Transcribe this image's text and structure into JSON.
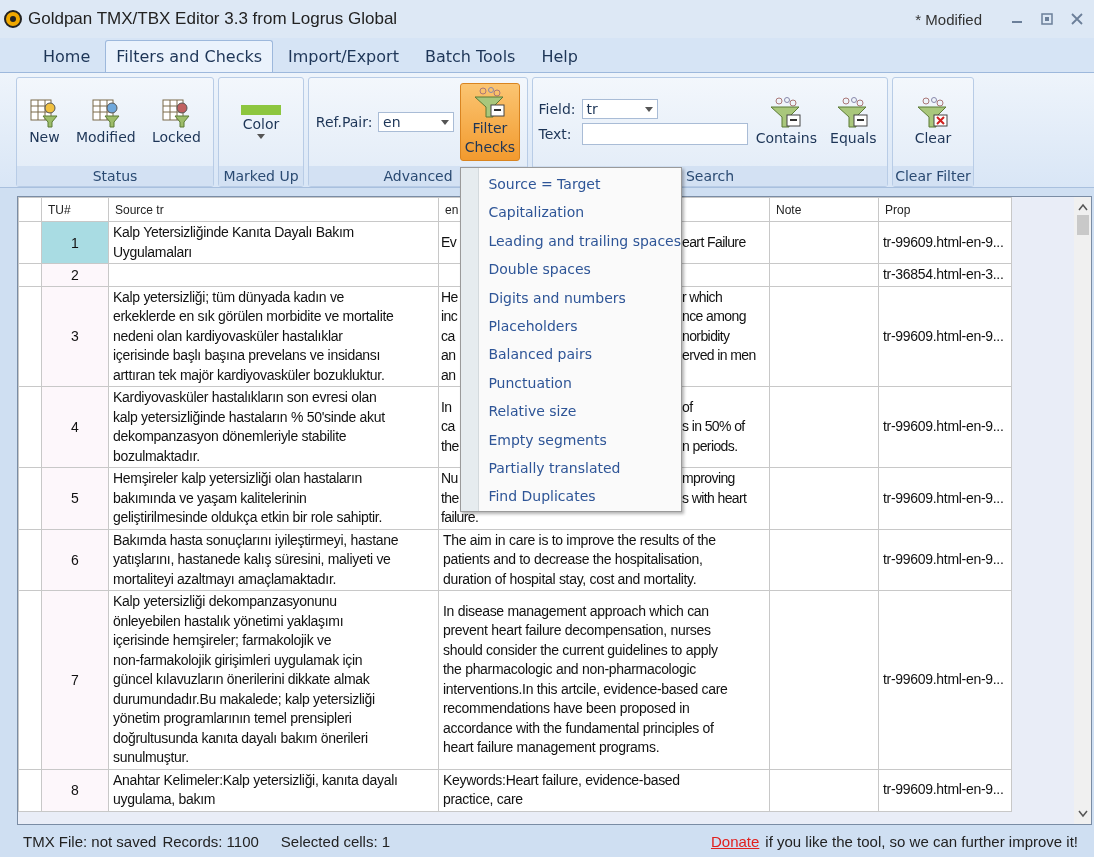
{
  "window": {
    "title": "Goldpan TMX/TBX Editor 3.3 from Logrus Global",
    "state": "* Modified"
  },
  "tabs": [
    {
      "label": "Home",
      "selected": false
    },
    {
      "label": "Filters and Checks",
      "selected": true
    },
    {
      "label": "Import/Export",
      "selected": false
    },
    {
      "label": "Batch Tools",
      "selected": false
    },
    {
      "label": "Help",
      "selected": false
    }
  ],
  "ribbon": {
    "groups": [
      {
        "kind": "status",
        "label": "Status",
        "buttons": [
          "New",
          "Modified",
          "Locked"
        ]
      },
      {
        "kind": "markup",
        "label": "Marked Up",
        "button": "Color",
        "color": "#8dc63f"
      },
      {
        "kind": "advanced",
        "label": "Advanced",
        "field_label": "Ref.Pair:",
        "field_value": "en",
        "button": "Filter\nChecks",
        "pressed": true
      },
      {
        "kind": "search",
        "label": "Search",
        "field_label": "Field:",
        "field_value": "tr",
        "text_label": "Text:",
        "buttons": [
          "Contains",
          "Equals"
        ]
      },
      {
        "kind": "clear",
        "label": "Clear Filter",
        "button": "Clear"
      }
    ]
  },
  "menu": {
    "items": [
      "Source = Target",
      "Capitalization",
      "Leading and trailing spaces",
      "Double spaces",
      "Digits and numbers",
      "Placeholders",
      "Balanced pairs",
      "Punctuation",
      "Relative size",
      "Empty segments",
      "Partially translated",
      "Find Duplicates"
    ]
  },
  "table": {
    "columns": [
      "TU#",
      "Source tr",
      "en",
      "Note",
      "Prop"
    ],
    "rows": [
      {
        "tu": "1",
        "selected": true,
        "source": "Kalp Yetersizliğinde Kanıta Dayalı Bakım\nUygulamaları",
        "target_fragments": [
          {
            "left": "Ev",
            "right": "eart Failure"
          }
        ],
        "prop": "tr-99609.html-en-9..."
      },
      {
        "tu": "2",
        "selected": false,
        "prop": "tr-36854.html-en-3..."
      },
      {
        "tu": "3",
        "selected": false,
        "source": "Kalp yetersizliği; tüm dünyada kadın ve\nerkeklerde en sık görülen morbidite ve mortalite\nnedeni olan kardiyovasküler hastalıklar\niçerisinde başlı başına prevelans ve insidansı\narttıran tek majör kardiyovasküler bozukluktur.",
        "target_fragments": [
          {
            "left": "He",
            "right": "r which"
          },
          {
            "left": "inc",
            "right": "nce among"
          },
          {
            "left": "ca",
            "right": "norbidity"
          },
          {
            "left": "an",
            "right": "erved in men"
          },
          {
            "left": "an"
          }
        ],
        "prop": "tr-99609.html-en-9..."
      },
      {
        "tu": "4",
        "selected": false,
        "source": "Kardiyovasküler hastalıkların son evresi olan\nkalp yetersizliğinde hastaların % 50'sinde akut\ndekompanzasyon dönemleriyle stabilite\nbozulmaktadır.",
        "target_fragments": [
          {
            "left": "In",
            "right": "of"
          },
          {
            "left": "ca",
            "right": "s in 50% of"
          },
          {
            "left": "the",
            "right": "n periods."
          }
        ],
        "prop": "tr-99609.html-en-9..."
      },
      {
        "tu": "5",
        "selected": false,
        "source": "Hemşireler kalp yetersizliği olan hastaların\nbakımında ve yaşam kalitelerinin\ngeliştirilmesinde oldukça etkin bir role sahiptir.",
        "target_fragments": [
          {
            "left": "Nu",
            "right": "mproving"
          },
          {
            "left": "the",
            "right": "s with heart"
          },
          {
            "left": "failure."
          }
        ],
        "prop": "tr-99609.html-en-9..."
      },
      {
        "tu": "6",
        "selected": false,
        "source": "Bakımda hasta sonuçlarını iyileştirmeyi, hastane\nyatışlarını, hastanede kalış süresini, maliyeti ve\nmortaliteyi azaltmayı amaçlamaktadır.",
        "target": "The aim in care is to improve the results of the\npatients and to decrease the hospitalisation,\nduration of hospital stay, cost and mortality.",
        "prop": "tr-99609.html-en-9..."
      },
      {
        "tu": "7",
        "selected": false,
        "source": "Kalp yetersizliği dekompanzasyonunu\nönleyebilen hastalık yönetimi yaklaşımı\niçerisinde hemşireler; farmakolojik ve\nnon-farmakolojik girişimleri uygulamak için\ngüncel kılavuzların önerilerini dikkate almak\ndurumundadır.Bu makalede; kalp yetersizliği\nyönetim programlarının temel prensipleri\ndoğrultusunda kanıta dayalı bakım önerileri\nsunulmuştur.",
        "target": "In disease management approach which can\nprevent heart failure decompensation, nurses\nshould consider the current guidelines to apply\nthe pharmacologic and non-pharmacologic\ninterventions.In this artcile, evidence-based care\nrecommendations have been proposed in\naccordance with the fundamental principles of\nheart failure management programs.",
        "prop": "tr-99609.html-en-9..."
      },
      {
        "tu": "8",
        "selected": false,
        "source": "Anahtar Kelimeler:Kalp yetersizliği, kanıta dayalı\nuygulama, bakım",
        "target": "Keywords:Heart failure, evidence-based\npractice, care",
        "prop": "tr-99609.html-en-9..."
      }
    ]
  },
  "status_bar": {
    "file": "TMX File: not saved",
    "records": "Records: 1100",
    "selected": "Selected cells: 1",
    "link": "Donate",
    "message": "if you like the tool, so we can further improve it!"
  }
}
